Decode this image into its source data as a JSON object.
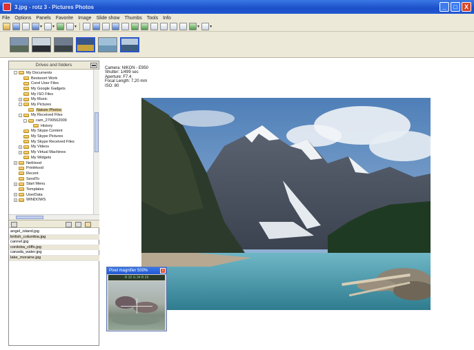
{
  "window": {
    "title": "3.jpg - rotz 3 - Pictures Photos",
    "buttons": {
      "minimize": "_",
      "maximize": "□",
      "close": "X"
    }
  },
  "menu": [
    "File",
    "Options",
    "Panels",
    "Favorite",
    "Image",
    "Slide show",
    "Thumbs",
    "Tools",
    "Info"
  ],
  "toolbar": {
    "icons": [
      "open-icon",
      "browse-icon",
      "thumbs-icon",
      "slideshow-icon",
      "save-icon",
      "rotate-icon",
      "fullscreen-icon",
      "text-icon",
      "grid-icon",
      "bar-icon",
      "zoom-in-icon",
      "zoom-out-icon",
      "fit-icon",
      "prev-icon",
      "next-icon",
      "first-icon",
      "last-icon",
      "delete-icon",
      "options-icon",
      "help-icon"
    ]
  },
  "thumbnails": [
    {
      "selected": false,
      "sky": "#7f94ad",
      "ground": "#5a6a58"
    },
    {
      "selected": false,
      "sky": "#c9d4dc",
      "ground": "#2b2f33"
    },
    {
      "selected": false,
      "sky": "#6f7c8e",
      "ground": "#3b4347"
    },
    {
      "selected": true,
      "sky": "#3a5587",
      "ground": "#c7a23c"
    },
    {
      "selected": false,
      "sky": "#9fc0d8",
      "ground": "#6b96b5"
    },
    {
      "selected": true,
      "sky": "#b7c9dd",
      "ground": "#3f5e7d"
    }
  ],
  "left_panel": {
    "header": "Drives and folders",
    "tree": [
      {
        "label": "My Documents",
        "indent": 3,
        "expander": "-",
        "selected": false
      },
      {
        "label": "Bestsoort Work",
        "indent": 4,
        "expander": "",
        "selected": false
      },
      {
        "label": "Corel User Files",
        "indent": 4,
        "expander": "",
        "selected": false
      },
      {
        "label": "My Google Gadgets",
        "indent": 4,
        "expander": "",
        "selected": false
      },
      {
        "label": "My ISO Files",
        "indent": 4,
        "expander": "",
        "selected": false
      },
      {
        "label": "My Music",
        "indent": 4,
        "expander": "+",
        "selected": false
      },
      {
        "label": "My Pictures",
        "indent": 4,
        "expander": "-",
        "selected": false
      },
      {
        "label": "Nature Photos",
        "indent": 5,
        "expander": "",
        "selected": true
      },
      {
        "label": "My Received Files",
        "indent": 4,
        "expander": "-",
        "selected": false
      },
      {
        "label": "cam_2700562009",
        "indent": 5,
        "expander": "-",
        "selected": false
      },
      {
        "label": "History",
        "indent": 6,
        "expander": "",
        "selected": false
      },
      {
        "label": "My Skype Content",
        "indent": 4,
        "expander": "",
        "selected": false
      },
      {
        "label": "My Skype Pictures",
        "indent": 4,
        "expander": "",
        "selected": false
      },
      {
        "label": "My Skype Received Files",
        "indent": 4,
        "expander": "",
        "selected": false
      },
      {
        "label": "My Videos",
        "indent": 4,
        "expander": "+",
        "selected": false
      },
      {
        "label": "My Virtual Machines",
        "indent": 4,
        "expander": "+",
        "selected": false
      },
      {
        "label": "My Widgets",
        "indent": 4,
        "expander": "",
        "selected": false
      },
      {
        "label": "NetHood",
        "indent": 3,
        "expander": "+",
        "selected": false
      },
      {
        "label": "PrintHood",
        "indent": 3,
        "expander": "",
        "selected": false
      },
      {
        "label": "Recent",
        "indent": 3,
        "expander": "",
        "selected": false
      },
      {
        "label": "SendTo",
        "indent": 3,
        "expander": "",
        "selected": false
      },
      {
        "label": "Start Menu",
        "indent": 3,
        "expander": "+",
        "selected": false
      },
      {
        "label": "Templates",
        "indent": 3,
        "expander": "",
        "selected": false
      },
      {
        "label": "UserData",
        "indent": 3,
        "expander": "+",
        "selected": false
      },
      {
        "label": "WINDOWS",
        "indent": 3,
        "expander": "+",
        "selected": false
      }
    ],
    "files": [
      "angel_island.jpg",
      "british_columbia.jpg",
      "cannel.jpg",
      "cordoba_cliffs.jpg",
      "canada_water.jpg",
      "lake_moraine.jpg"
    ]
  },
  "exif": [
    "Camera: NIKON - E950",
    "Shutter: 1/499 sec",
    "Aperture: F7.4",
    "Focal Length: 7,20 mm",
    "ISO: 80"
  ],
  "magnifier": {
    "title": "Pixel magnifier 500%",
    "info": "R 32 G 34 B 29",
    "close": "x"
  }
}
